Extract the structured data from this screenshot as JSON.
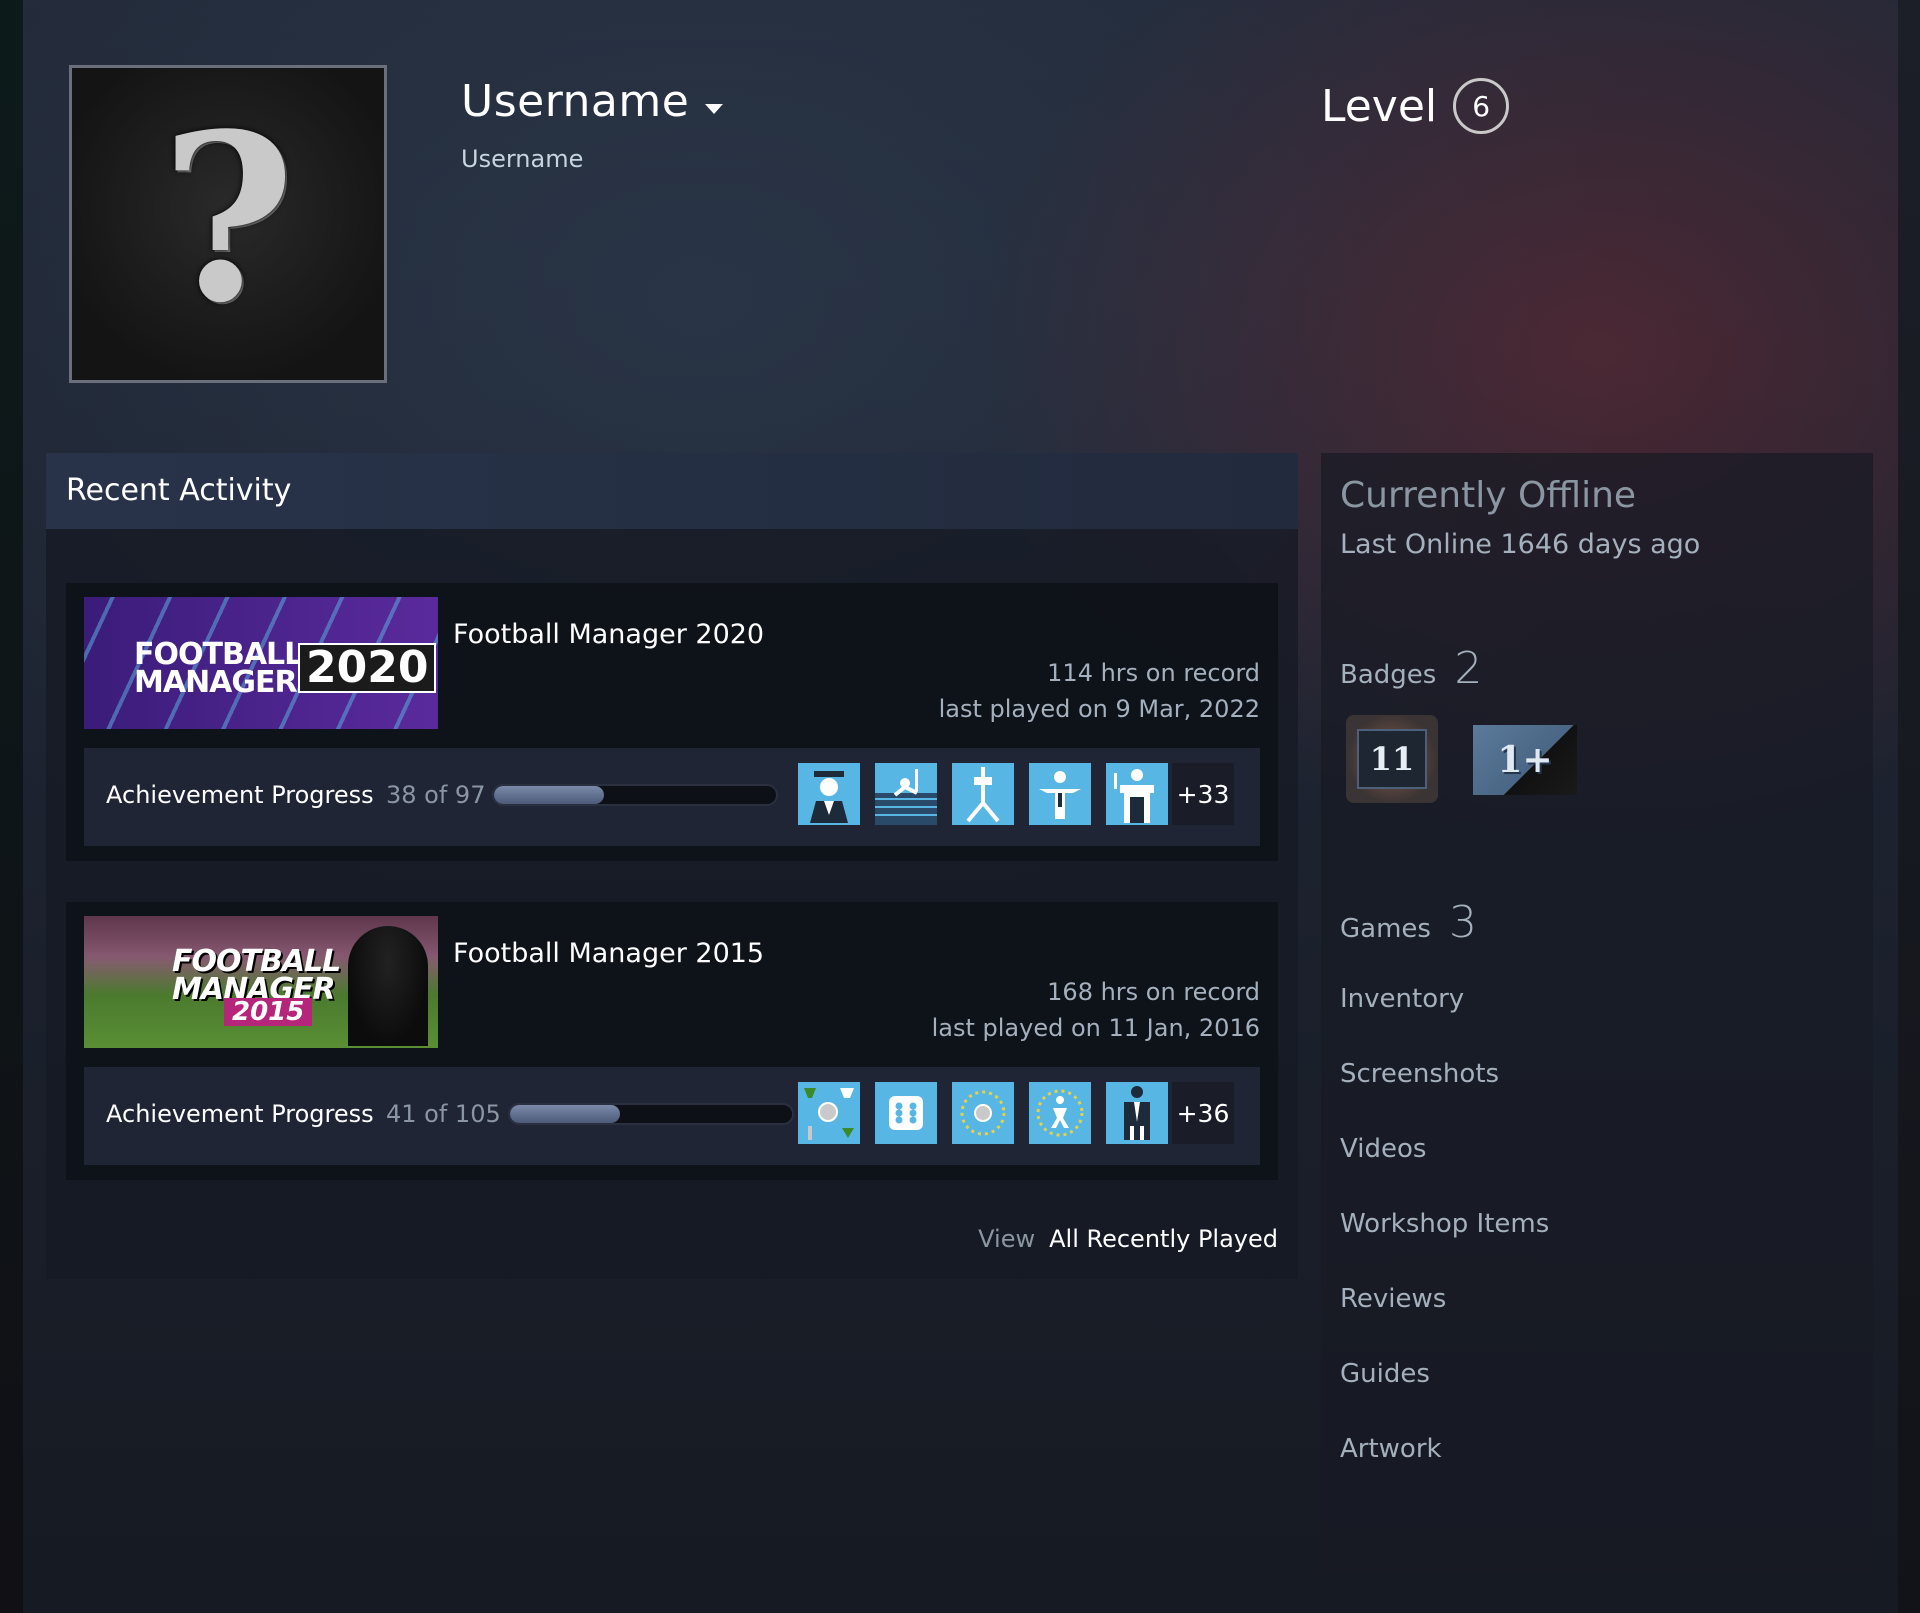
{
  "profile": {
    "persona_name": "Username",
    "real_name": "Username",
    "level_label": "Level",
    "level": "6",
    "avatar_glyph": "?"
  },
  "recent_activity": {
    "title": "Recent Activity",
    "games": [
      {
        "name": "Football Manager 2020",
        "capsule_text": "FOOTBALL MANAGER",
        "capsule_year": "2020",
        "hours": "114 hrs on record",
        "last_played": "last played on 9 Mar, 2022",
        "achievement_label": "Achievement Progress",
        "achievement_count": "38 of 97",
        "achievement_fraction": 0.39,
        "achievement_icons": [
          "graduate-icon",
          "wall-climb-icon",
          "podium-icon",
          "player-icon",
          "manager-icon"
        ],
        "more_achievements": "+33"
      },
      {
        "name": "Football Manager 2015",
        "capsule_text": "FOOTBALL MANAGER",
        "capsule_year": "2015",
        "hours": "168 hrs on record",
        "last_played": "last played on 11 Jan, 2016",
        "achievement_label": "Achievement Progress",
        "achievement_count": "41 of 105",
        "achievement_fraction": 0.39,
        "achievement_icons": [
          "trophy-icon",
          "dice-icon",
          "stars-ring-icon",
          "stars-player-icon",
          "suit-icon"
        ],
        "more_achievements": "+36"
      }
    ],
    "view_word": "View",
    "view_link": "All Recently Played"
  },
  "sidebar": {
    "status": "Currently Offline",
    "last_online": "Last Online 1646 days ago",
    "badges_label": "Badges",
    "badges_count": "2",
    "badge_years_text": "11",
    "badge_game_text": "1+",
    "games_label": "Games",
    "games_count": "3",
    "links": [
      "Inventory",
      "Screenshots",
      "Videos",
      "Workshop Items",
      "Reviews",
      "Guides",
      "Artwork"
    ]
  },
  "colors": {
    "achievement_icon_bg": "#58b6e5",
    "capsule_2020_bg": "#4a2590",
    "text_muted": "#a4b0bd"
  }
}
